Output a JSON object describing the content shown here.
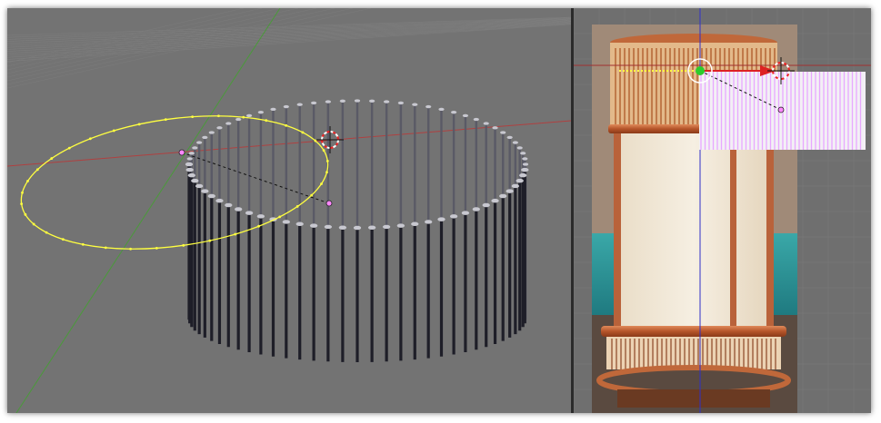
{
  "left_view": {
    "posts": {
      "count": 72
    },
    "colors": {
      "background": "#737373",
      "grid": "#6a6a6a",
      "x_axis": "#b04040",
      "y_axis": "#4a9a3a",
      "post_dark": "#1e1e28",
      "post_mid": "#5a5a66",
      "post_top": "#c8c8d0",
      "selection": "#ffff40",
      "vertex": "#ff88ff"
    }
  },
  "right_view": {
    "reference_image": "lantern-photo",
    "rail_count": 40,
    "colors": {
      "background": "#6f6f6f",
      "x_axis": "#a03030",
      "z_axis": "#3030c8",
      "rails": "#e8a8ff",
      "rail_bg": "#f3f0f5",
      "pivot": "#ffffff",
      "center": "#2ccc2c",
      "arrow": "#dd2222",
      "selection": "#ffff40"
    }
  }
}
